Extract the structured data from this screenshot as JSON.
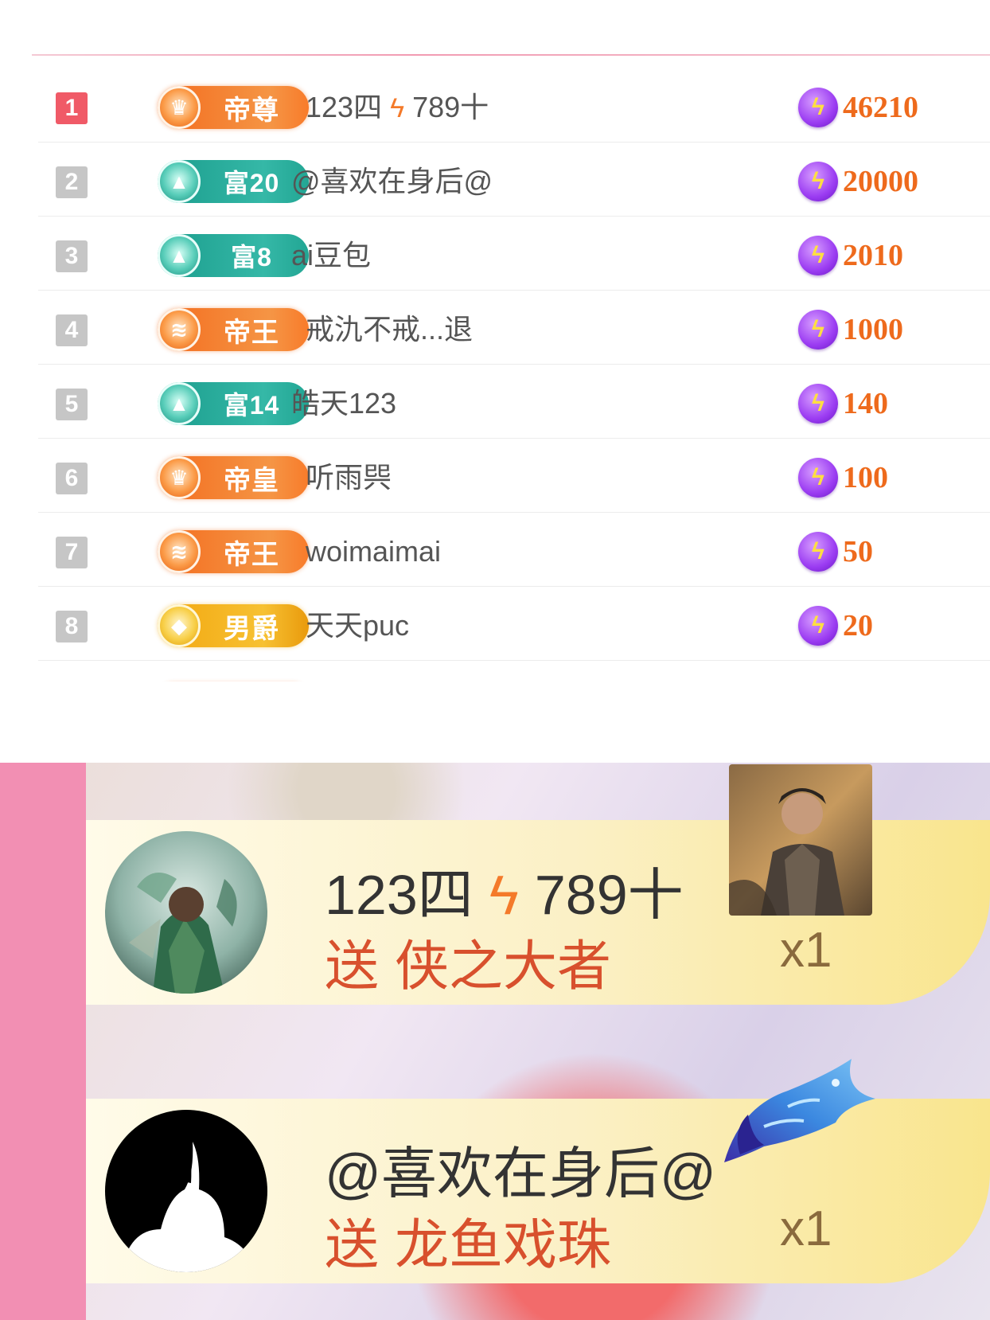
{
  "ranking": {
    "rows": [
      {
        "rank": "1",
        "badge_label": "帝尊",
        "badge_style": "orange",
        "badge_icon": "crown-icon",
        "badge_glyph": "♛",
        "name": "123四",
        "name_suffix": "789十",
        "has_bolt": true,
        "score": "46210"
      },
      {
        "rank": "2",
        "badge_label": "富20",
        "badge_style": "teal",
        "badge_icon": "triangle-gem-icon",
        "badge_glyph": "▲",
        "name": "@喜欢在身后@",
        "name_suffix": "",
        "has_bolt": false,
        "score": "20000"
      },
      {
        "rank": "3",
        "badge_label": "富8",
        "badge_style": "teal",
        "badge_icon": "triangle-gem-icon",
        "badge_glyph": "▲",
        "name": "ai豆包",
        "name_suffix": "",
        "has_bolt": false,
        "score": "2010"
      },
      {
        "rank": "4",
        "badge_label": "帝王",
        "badge_style": "orange",
        "badge_icon": "chevrons-icon",
        "badge_glyph": "≋",
        "name": "戒氿不戒...退",
        "name_suffix": "",
        "has_bolt": false,
        "score": "1000"
      },
      {
        "rank": "5",
        "badge_label": "富14",
        "badge_style": "teal",
        "badge_icon": "triangle-gem-icon",
        "badge_glyph": "▲",
        "name": "皓天123",
        "name_suffix": "",
        "has_bolt": false,
        "score": "140"
      },
      {
        "rank": "6",
        "badge_label": "帝皇",
        "badge_style": "orange",
        "badge_icon": "crown-icon",
        "badge_glyph": "♛",
        "name": "听雨巺",
        "name_suffix": "",
        "has_bolt": false,
        "score": "100"
      },
      {
        "rank": "7",
        "badge_label": "帝王",
        "badge_style": "orange",
        "badge_icon": "chevrons-icon",
        "badge_glyph": "≋",
        "name": "woimaimai",
        "name_suffix": "",
        "has_bolt": false,
        "score": "50"
      },
      {
        "rank": "8",
        "badge_label": "男爵",
        "badge_style": "gold",
        "badge_icon": "diamond-icon",
        "badge_glyph": "◆",
        "name": "天天puc",
        "name_suffix": "",
        "has_bolt": false,
        "score": "20"
      }
    ],
    "score_icon": "lightning-coin-icon",
    "bolt_glyph": "ϟ",
    "colors": {
      "accent_orange": "#ee6a1c",
      "rank_top": "#f05a67",
      "rank_other": "#c6c6c6"
    }
  },
  "gifts": [
    {
      "sender": "123四",
      "sender_suffix": "789十",
      "has_bolt": true,
      "verb": "送",
      "gift_name": "侠之大者",
      "count": "x1",
      "avatar_icon": "warrior-avatar",
      "gift_icon": "hero-portrait-gift"
    },
    {
      "sender": "@喜欢在身后@",
      "sender_suffix": "",
      "has_bolt": false,
      "verb": "送",
      "gift_name": "龙鱼戏珠",
      "count": "x1",
      "avatar_icon": "silhouette-avatar",
      "gift_icon": "dragon-fish-gift"
    }
  ],
  "colors": {
    "gift_text": "#d8502d",
    "side_strip": "#f28fb3"
  }
}
